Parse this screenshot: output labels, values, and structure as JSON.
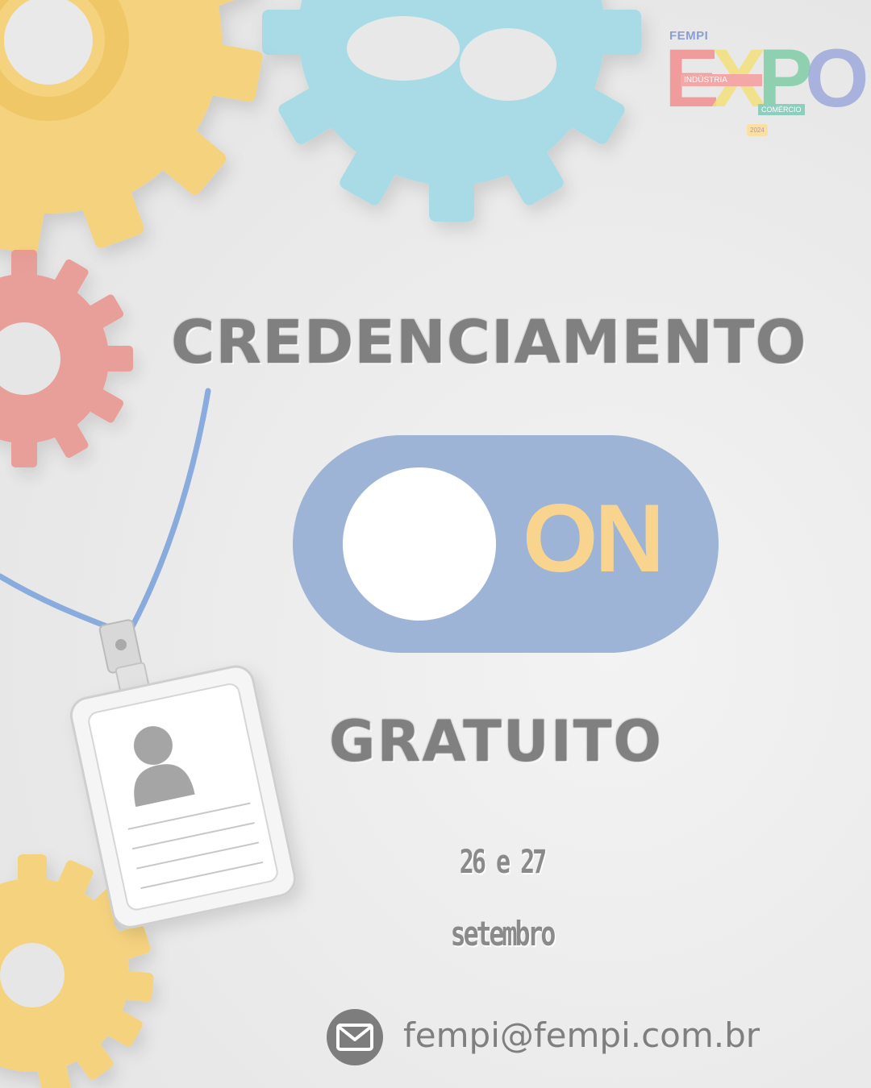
{
  "logo": {
    "top_label": "FEMPI",
    "word_letters": [
      "E",
      "X",
      "P",
      "O"
    ],
    "industry_label": "INDÚSTRIA",
    "commerce_label": "COMÉRCIO",
    "year": "2024"
  },
  "headline": "CREDENCIAMENTO",
  "toggle": {
    "label": "ON",
    "state": "on",
    "track_color": "#9db4d6",
    "label_color": "#f8d48e"
  },
  "subheadline": "GRATUITO",
  "dates": {
    "days": "26 e 27",
    "month": "setembro"
  },
  "contact": {
    "icon": "envelope-icon",
    "email": "fempi@fempi.com.br"
  },
  "colors": {
    "gear_yellow": "#f5d080",
    "gear_blue": "#9fd6e2",
    "gear_red": "#e8958f",
    "lanyard": "#7ea4dc"
  }
}
